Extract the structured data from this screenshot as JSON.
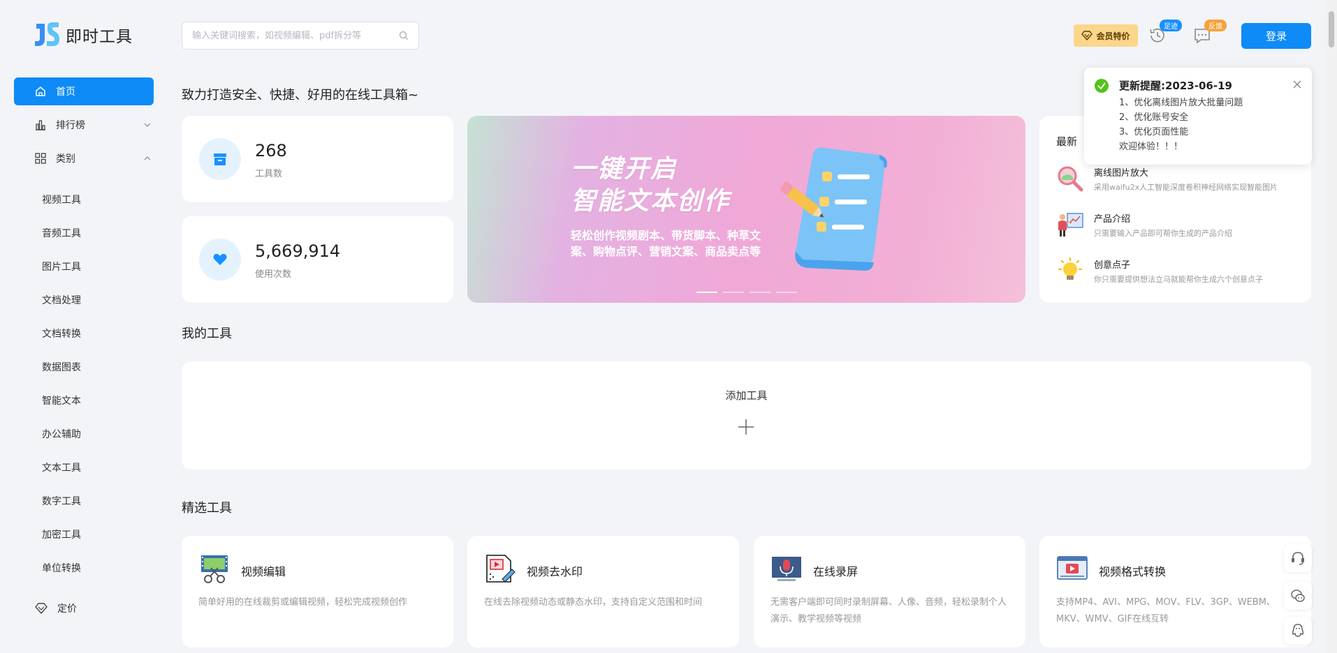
{
  "app": {
    "logo_text": "即时工具"
  },
  "search": {
    "placeholder": "输入关键词搜索，如视频编辑、pdf拆分等",
    "value": ""
  },
  "header": {
    "vip_label": "会员特价",
    "history_badge": "足迹",
    "feedback_badge": "反馈",
    "login_label": "登录"
  },
  "sidebar": {
    "home": "首页",
    "ranking": "排行榜",
    "category": "类别",
    "subitems": [
      "视频工具",
      "音频工具",
      "图片工具",
      "文档处理",
      "文档转换",
      "数据图表",
      "智能文本",
      "办公辅助",
      "文本工具",
      "数字工具",
      "加密工具",
      "单位转换"
    ],
    "pricing": "定价"
  },
  "main": {
    "slogan": "致力打造安全、快捷、好用的在线工具箱~",
    "stats": [
      {
        "value": "268",
        "label": "工具数"
      },
      {
        "value": "5,669,914",
        "label": "使用次数"
      }
    ],
    "banner": {
      "title": "一键开启\n智能文本创作",
      "subtitle": "轻松创作视频剧本、带货脚本、种草文案、购物点评、营销文案、商品卖点等",
      "active_slide": 1,
      "slide_count": 4
    },
    "latest": {
      "title": "最新",
      "items": [
        {
          "name": "离线图片放大",
          "desc": "采用waifu2x人工智能深度卷积神经网络实现智能图片",
          "icon": "magnifier-icon"
        },
        {
          "name": "产品介绍",
          "desc": "只需要输入产品即可帮你生成的产品介绍",
          "icon": "presenter-icon"
        },
        {
          "name": "创意点子",
          "desc": "你只需要提供想法立马就能帮你生成六个创意点子",
          "icon": "lightbulb-icon"
        }
      ]
    },
    "my_tools_title": "我的工具",
    "add_tool_label": "添加工具",
    "featured_title": "精选工具",
    "featured": [
      {
        "name": "视频编辑",
        "desc": "简单好用的在线裁剪或编辑视频，轻松完成视频创作",
        "icon": "film-scissors-icon"
      },
      {
        "name": "视频去水印",
        "desc": "在线去除视频动态或静态水印，支持自定义范围和时间",
        "icon": "video-eraser-icon"
      },
      {
        "name": "在线录屏",
        "desc": "无需客户端即可同时录制屏幕、人像、音频，轻松录制个人演示、教学视频等视频",
        "icon": "microphone-screen-icon"
      },
      {
        "name": "视频格式转换",
        "desc": "支持MP4、AVI、MPG、MOV、FLV、3GP、WEBM、MKV、WMV、GIF在线互转",
        "icon": "video-convert-icon"
      }
    ]
  },
  "notice": {
    "title": "更新提醒:2023-06-19",
    "lines": [
      "1、优化离线图片放大批量问题",
      "2、优化账号安全",
      "3、优化页面性能",
      "欢迎体验！！！"
    ]
  },
  "colors": {
    "primary": "#0e8bf6",
    "vip": "#fbd68c",
    "background": "#f3f4f8",
    "success": "#52c41a"
  }
}
